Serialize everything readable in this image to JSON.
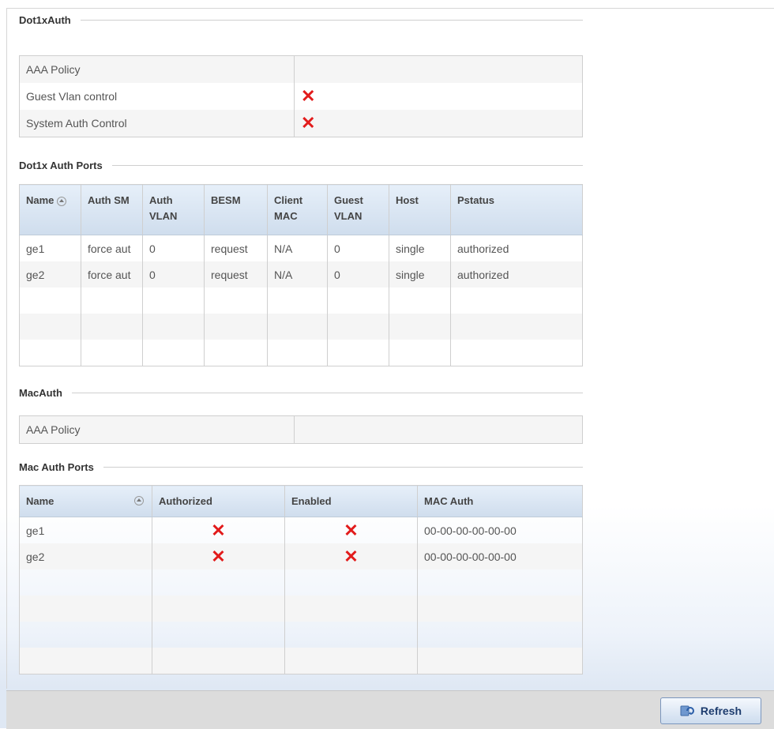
{
  "dot1xauth": {
    "title": "Dot1xAuth",
    "rows": [
      {
        "label": "AAA Policy",
        "value": ""
      },
      {
        "label": "Guest Vlan control",
        "value": "✕"
      },
      {
        "label": "System Auth Control",
        "value": "✕"
      }
    ]
  },
  "dot1x_ports": {
    "title": "Dot1x Auth Ports",
    "headers": [
      "Name",
      "Auth SM",
      "Auth VLAN",
      "BESM",
      "Client MAC",
      "Guest VLAN",
      "Host",
      "Pstatus"
    ],
    "rows": [
      [
        "ge1",
        "force aut",
        "0",
        "request",
        "N/A",
        "0",
        "single",
        "authorized"
      ],
      [
        "ge2",
        "force aut",
        "0",
        "request",
        "N/A",
        "0",
        "single",
        "authorized"
      ]
    ]
  },
  "macauth": {
    "title": "MacAuth",
    "rows": [
      {
        "label": "AAA Policy",
        "value": ""
      }
    ]
  },
  "mac_ports": {
    "title": "Mac Auth Ports",
    "headers": [
      "Name",
      "Authorized",
      "Enabled",
      "MAC Auth"
    ],
    "rows": [
      {
        "name": "ge1",
        "authorized": "✕",
        "enabled": "✕",
        "mac": "00-00-00-00-00-00"
      },
      {
        "name": "ge2",
        "authorized": "✕",
        "enabled": "✕",
        "mac": "00-00-00-00-00-00"
      }
    ]
  },
  "footer": {
    "refresh_label": "Refresh"
  },
  "icons": {
    "false_mark": "x-icon",
    "sort": "sort-asc-icon",
    "refresh": "refresh-icon"
  },
  "colors": {
    "false_mark": "#e21b1b",
    "header_bg": "#d9e5f2",
    "button_text": "#1d3c6e"
  }
}
